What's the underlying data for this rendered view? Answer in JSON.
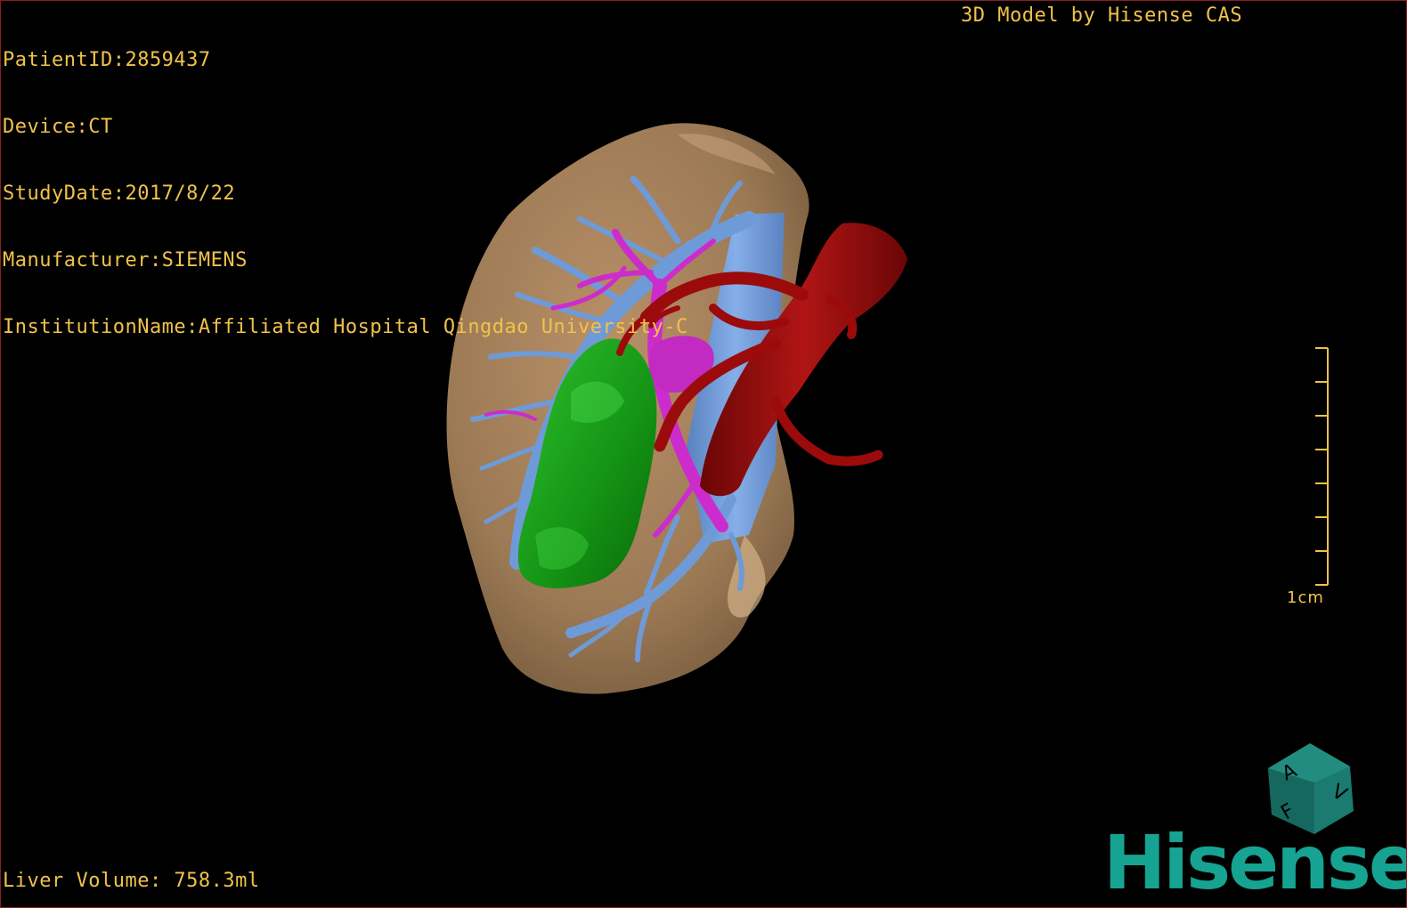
{
  "patient_info": {
    "patient_id": "PatientID:2859437",
    "device": "Device:CT",
    "study_date": "StudyDate:2017/8/22",
    "manufacturer": "Manufacturer:SIEMENS",
    "institution": "InstitutionName:Affiliated Hospital Qingdao University-C"
  },
  "viewer_title": "3D Model by Hisense CAS",
  "liver_volume": "Liver Volume: 758.3ml",
  "scale_bar": {
    "label": "1cm",
    "tick_count": 8
  },
  "orientation_cube": {
    "labels": [
      "A",
      "F",
      "V"
    ]
  },
  "logo_text": "Hisense",
  "colors": {
    "overlay_text": "#f0c24a",
    "liver": "#a07f5a",
    "hepatic_vein": "#6f9ad8",
    "portal_vein": "#cc2ccc",
    "tumor": "#1e9e1e",
    "artery": "#9b0b0b",
    "brand": "#16a391",
    "border": "#8a2020"
  },
  "icons": {
    "orientation_cube": "orientation-cube-icon",
    "scale_bar": "scale-ruler-icon"
  }
}
